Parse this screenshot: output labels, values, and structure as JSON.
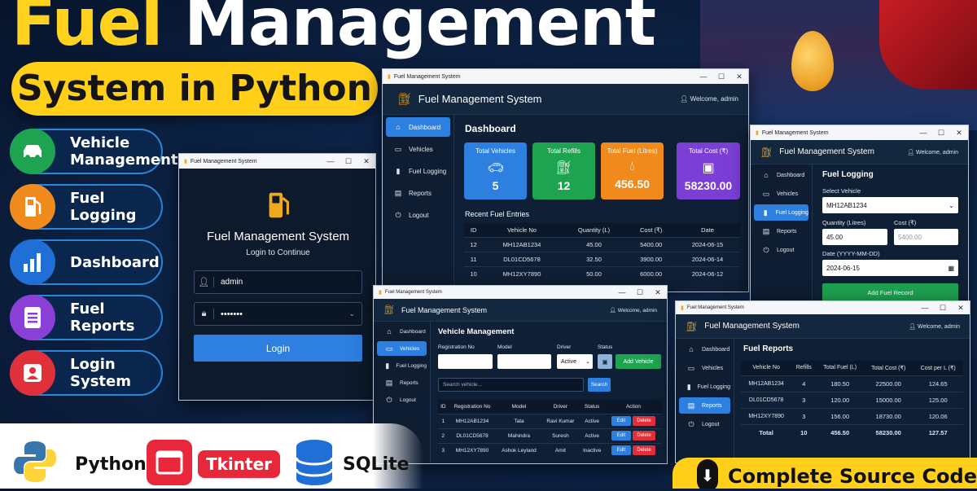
{
  "hero": {
    "title_part1": "Fuel",
    "title_part2": "Management",
    "subtitle": "System in Python"
  },
  "features": [
    {
      "label": "Vehicle Management",
      "icon": "car-icon",
      "color": "#1ea351"
    },
    {
      "label": "Fuel Logging",
      "icon": "fuel-pump-icon",
      "color": "#f08a1c"
    },
    {
      "label": "Dashboard",
      "icon": "bar-chart-icon",
      "color": "#1f6fd6"
    },
    {
      "label": "Fuel Reports",
      "icon": "document-icon",
      "color": "#8a3fd6"
    },
    {
      "label": "Login System",
      "icon": "user-icon",
      "color": "#e0303a"
    }
  ],
  "tech": {
    "python": "Python",
    "tkinter": "Tkinter",
    "sqlite": "SQLite"
  },
  "cta": "Complete Source Code",
  "app_name": "Fuel Management System",
  "welcome": "Welcome, admin",
  "login": {
    "window_title": "Fuel Management System",
    "heading": "Fuel Management System",
    "subheading": "Login to Continue",
    "username": "admin",
    "password": "•••••••",
    "button": "Login"
  },
  "nav": [
    "Dashboard",
    "Vehicles",
    "Fuel Logging",
    "Reports",
    "Logout"
  ],
  "dashboard": {
    "window_title": "Fuel Management System",
    "title": "Dashboard",
    "cards": [
      {
        "label": "Total Vehicles",
        "value": "5",
        "color": "#2d7fe0",
        "icon": "car-icon"
      },
      {
        "label": "Total Refills",
        "value": "12",
        "color": "#1ea351",
        "icon": "fuel-pump-icon"
      },
      {
        "label": "Total Fuel (Litres)",
        "value": "456.50",
        "color": "#f08a1c",
        "icon": "drop-icon"
      },
      {
        "label": "Total Cost (₹)",
        "value": "58230.00",
        "color": "#7b3fd6",
        "icon": "wallet-icon"
      }
    ],
    "recent_title": "Recent Fuel Entries",
    "columns": [
      "ID",
      "Vehicle No",
      "Quantity (L)",
      "Cost (₹)",
      "Date"
    ],
    "rows": [
      [
        "12",
        "MH12AB1234",
        "45.00",
        "5400.00",
        "2024-06-15"
      ],
      [
        "11",
        "DL01CD5678",
        "32.50",
        "3900.00",
        "2024-06-14"
      ],
      [
        "10",
        "MH12XY7890",
        "50.00",
        "6000.00",
        "2024-06-12"
      ]
    ]
  },
  "fuel_logging": {
    "window_title": "Fuel Management System",
    "title": "Fuel Logging",
    "select_label": "Select Vehicle",
    "select_value": "MH12AB1234",
    "qty_label": "Quantity (Litres)",
    "qty_value": "45.00",
    "cost_label": "Cost (₹)",
    "cost_placeholder": "5400.00",
    "date_label": "Date (YYYY-MM-DD)",
    "date_value": "2024-06-15",
    "button": "Add Fuel Record"
  },
  "vehicles": {
    "window_title": "Fuel Management System",
    "title": "Vehicle Management",
    "reg_label": "Registration No",
    "model_label": "Model",
    "driver_label": "Driver",
    "status_label": "Status",
    "status_value": "Active",
    "add_button": "Add Vehicle",
    "search_placeholder": "Search vehicle...",
    "search_button": "Search",
    "columns": [
      "ID",
      "Registration No",
      "Model",
      "Driver",
      "Status",
      "Action"
    ],
    "rows": [
      [
        "1",
        "MH12AB1234",
        "Tata",
        "Ravi Kumar",
        "Active"
      ],
      [
        "2",
        "DL01CD5678",
        "Mahindra",
        "Suresh",
        "Active"
      ],
      [
        "3",
        "MH12XY7890",
        "Ashok Leyland",
        "Amit",
        "Inactive"
      ]
    ],
    "edit": "Edit",
    "delete": "Delete"
  },
  "reports": {
    "window_title": "Fuel Management System",
    "title": "Fuel Reports",
    "columns": [
      "Vehicle No",
      "Refills",
      "Total Fuel (L)",
      "Total Cost (₹)",
      "Cost per L (₹)"
    ],
    "rows": [
      [
        "MH12AB1234",
        "4",
        "180.50",
        "22500.00",
        "124.65"
      ],
      [
        "DL01CD5678",
        "3",
        "120.00",
        "15000.00",
        "125.00"
      ],
      [
        "MH12XY7890",
        "3",
        "156.00",
        "18730.00",
        "120.06"
      ]
    ],
    "total": [
      "Total",
      "10",
      "456.50",
      "58230.00",
      "127.57"
    ]
  }
}
